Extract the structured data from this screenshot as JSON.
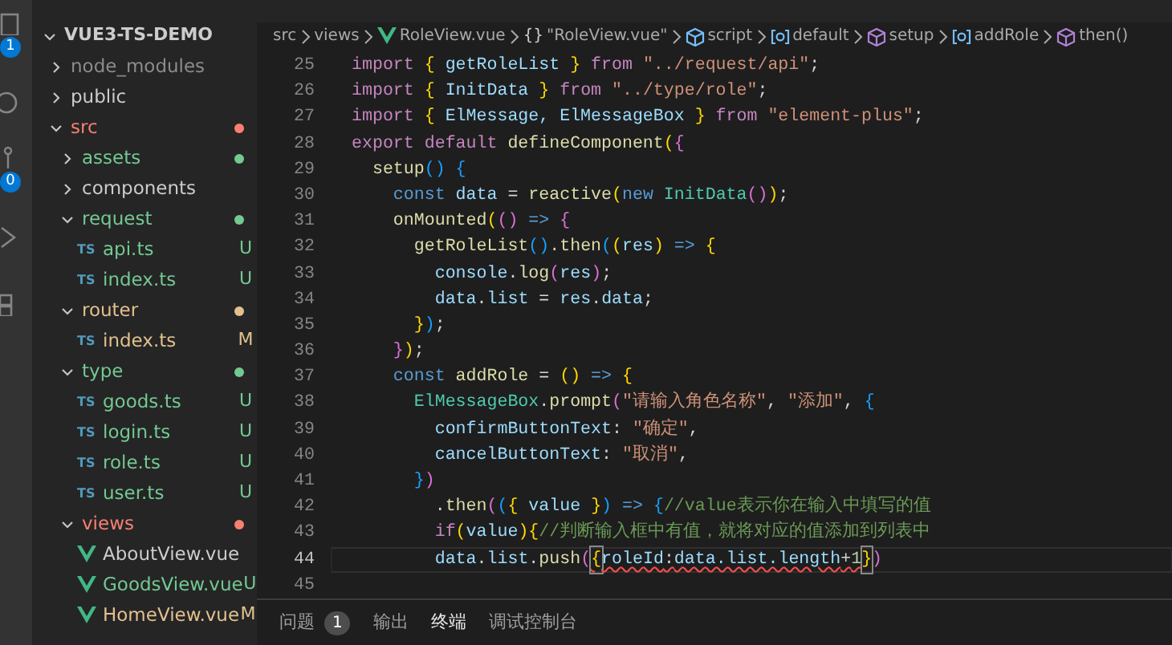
{
  "activity_bar": [
    {
      "kind": "explorer",
      "badge": "1"
    },
    {
      "kind": "search"
    },
    {
      "kind": "source-control",
      "badge": "0"
    },
    {
      "kind": "run"
    },
    {
      "kind": "extensions"
    }
  ],
  "explorer": {
    "label": "VUE3-TS-DEMO",
    "expanded": true,
    "children": [
      {
        "label": "node_modules",
        "kind": "folder",
        "expanded": false,
        "color": "#8c8c8c"
      },
      {
        "label": "public",
        "kind": "folder",
        "expanded": false,
        "color": "#cccccc"
      },
      {
        "label": "src",
        "kind": "folder",
        "expanded": true,
        "color": "#f88070",
        "dot": true,
        "children": [
          {
            "label": "assets",
            "kind": "folder",
            "expanded": false,
            "color": "#73c991",
            "dot": true
          },
          {
            "label": "components",
            "kind": "folder",
            "expanded": false,
            "color": "#cccccc"
          },
          {
            "label": "request",
            "kind": "folder",
            "expanded": true,
            "color": "#73c991",
            "dot": true,
            "children": [
              {
                "label": "api.ts",
                "kind": "ts",
                "icon_text": "TS",
                "color": "#73c991",
                "status": "U"
              },
              {
                "label": "index.ts",
                "kind": "ts",
                "icon_text": "TS",
                "color": "#73c991",
                "status": "U"
              }
            ]
          },
          {
            "label": "router",
            "kind": "folder",
            "expanded": true,
            "color": "#e2c08d",
            "dot": true,
            "children": [
              {
                "label": "index.ts",
                "kind": "ts",
                "icon_text": "TS",
                "color": "#e2c08d",
                "status": "M"
              }
            ]
          },
          {
            "label": "type",
            "kind": "folder",
            "expanded": true,
            "color": "#73c991",
            "dot": true,
            "children": [
              {
                "label": "goods.ts",
                "kind": "ts",
                "icon_text": "TS",
                "color": "#73c991",
                "status": "U"
              },
              {
                "label": "login.ts",
                "kind": "ts",
                "icon_text": "TS",
                "color": "#73c991",
                "status": "U"
              },
              {
                "label": "role.ts",
                "kind": "ts",
                "icon_text": "TS",
                "color": "#73c991",
                "status": "U"
              },
              {
                "label": "user.ts",
                "kind": "ts",
                "icon_text": "TS",
                "color": "#73c991",
                "status": "U"
              }
            ]
          },
          {
            "label": "views",
            "kind": "folder",
            "expanded": true,
            "color": "#f88070",
            "dot": true,
            "children": [
              {
                "label": "AboutView.vue",
                "kind": "vue",
                "color": "#cccccc"
              },
              {
                "label": "GoodsView.vue",
                "kind": "vue",
                "color": "#73c991",
                "status": "U"
              },
              {
                "label": "HomeView.vue",
                "kind": "vue",
                "color": "#e2c08d",
                "status": "M"
              }
            ]
          }
        ]
      }
    ]
  },
  "breadcrumb": [
    {
      "label": "src",
      "kind": "folder"
    },
    {
      "label": "views",
      "kind": "folder"
    },
    {
      "label": "RoleView.vue",
      "kind": "vue"
    },
    {
      "label": "\"RoleView.vue\"",
      "kind": "module",
      "icon_text": "{}"
    },
    {
      "label": "script",
      "kind": "script"
    },
    {
      "label": "default",
      "kind": "field"
    },
    {
      "label": "setup",
      "kind": "method"
    },
    {
      "label": "addRole",
      "kind": "field"
    },
    {
      "label": "then()",
      "kind": "method"
    }
  ],
  "editor": {
    "lines": [
      {
        "number": "25",
        "tokens": [
          {
            "kind": "kw",
            "text": "import "
          },
          {
            "kind": "b1",
            "text": "{"
          },
          {
            "kind": "var",
            "text": " getRoleList "
          },
          {
            "kind": "b1",
            "text": "}"
          },
          {
            "kind": "kw",
            "text": " from "
          },
          {
            "kind": "str",
            "text": "\"../request/api\""
          },
          {
            "kind": "p",
            "text": ";"
          }
        ]
      },
      {
        "number": "26",
        "tokens": [
          {
            "kind": "kw",
            "text": "import "
          },
          {
            "kind": "b1",
            "text": "{"
          },
          {
            "kind": "var",
            "text": " InitData "
          },
          {
            "kind": "b1",
            "text": "}"
          },
          {
            "kind": "kw",
            "text": " from "
          },
          {
            "kind": "str",
            "text": "\"../type/role\""
          },
          {
            "kind": "p",
            "text": ";"
          }
        ]
      },
      {
        "number": "27",
        "tokens": [
          {
            "kind": "kw",
            "text": "import "
          },
          {
            "kind": "b1",
            "text": "{"
          },
          {
            "kind": "var",
            "text": " ElMessage, ElMessageBox "
          },
          {
            "kind": "b1",
            "text": "}"
          },
          {
            "kind": "kw",
            "text": " from "
          },
          {
            "kind": "str",
            "text": "\"element-plus\""
          },
          {
            "kind": "p",
            "text": ";"
          }
        ]
      },
      {
        "number": "28",
        "tokens": [
          {
            "kind": "kw",
            "text": "export default "
          },
          {
            "kind": "fn",
            "text": "defineComponent"
          },
          {
            "kind": "b1",
            "text": "("
          },
          {
            "kind": "b2",
            "text": "{"
          }
        ]
      },
      {
        "number": "29",
        "tokens": [
          {
            "kind": "fn",
            "text": "  setup"
          },
          {
            "kind": "b3",
            "text": "()"
          },
          {
            "kind": "b3",
            "text": " {"
          }
        ]
      },
      {
        "number": "30",
        "tokens": [
          {
            "kind": "st",
            "text": "    const "
          },
          {
            "kind": "var",
            "text": "data"
          },
          {
            "kind": "p",
            "text": " = "
          },
          {
            "kind": "fn",
            "text": "reactive"
          },
          {
            "kind": "b1",
            "text": "("
          },
          {
            "kind": "st",
            "text": "new "
          },
          {
            "kind": "cls",
            "text": "InitData"
          },
          {
            "kind": "b2",
            "text": "()"
          },
          {
            "kind": "b1",
            "text": ")"
          },
          {
            "kind": "p",
            "text": ";"
          }
        ]
      },
      {
        "number": "31",
        "tokens": [
          {
            "kind": "fn",
            "text": "    onMounted"
          },
          {
            "kind": "b1",
            "text": "("
          },
          {
            "kind": "b2",
            "text": "()"
          },
          {
            "kind": "st",
            "text": " => "
          },
          {
            "kind": "b2",
            "text": "{"
          }
        ]
      },
      {
        "number": "32",
        "tokens": [
          {
            "kind": "fn",
            "text": "      getRoleList"
          },
          {
            "kind": "b3",
            "text": "()"
          },
          {
            "kind": "p",
            "text": "."
          },
          {
            "kind": "fn",
            "text": "then"
          },
          {
            "kind": "b3",
            "text": "("
          },
          {
            "kind": "b1",
            "text": "("
          },
          {
            "kind": "var",
            "text": "res"
          },
          {
            "kind": "b1",
            "text": ")"
          },
          {
            "kind": "st",
            "text": " => "
          },
          {
            "kind": "b1",
            "text": "{"
          }
        ]
      },
      {
        "number": "33",
        "tokens": [
          {
            "kind": "var",
            "text": "        console"
          },
          {
            "kind": "p",
            "text": "."
          },
          {
            "kind": "fn",
            "text": "log"
          },
          {
            "kind": "b2",
            "text": "("
          },
          {
            "kind": "var",
            "text": "res"
          },
          {
            "kind": "b2",
            "text": ")"
          },
          {
            "kind": "p",
            "text": ";"
          }
        ]
      },
      {
        "number": "34",
        "tokens": [
          {
            "kind": "var",
            "text": "        data"
          },
          {
            "kind": "p",
            "text": "."
          },
          {
            "kind": "var",
            "text": "list"
          },
          {
            "kind": "p",
            "text": " = "
          },
          {
            "kind": "var",
            "text": "res"
          },
          {
            "kind": "p",
            "text": "."
          },
          {
            "kind": "var",
            "text": "data"
          },
          {
            "kind": "p",
            "text": ";"
          }
        ]
      },
      {
        "number": "35",
        "tokens": [
          {
            "kind": "b1",
            "text": "      }"
          },
          {
            "kind": "b3",
            "text": ")"
          },
          {
            "kind": "p",
            "text": ";"
          }
        ]
      },
      {
        "number": "36",
        "tokens": [
          {
            "kind": "b2",
            "text": "    }"
          },
          {
            "kind": "b1",
            "text": ")"
          },
          {
            "kind": "p",
            "text": ";"
          }
        ]
      },
      {
        "number": "37",
        "tokens": [
          {
            "kind": "st",
            "text": "    const "
          },
          {
            "kind": "fn",
            "text": "addRole"
          },
          {
            "kind": "p",
            "text": " = "
          },
          {
            "kind": "b1",
            "text": "()"
          },
          {
            "kind": "st",
            "text": " => "
          },
          {
            "kind": "b1",
            "text": "{"
          }
        ]
      },
      {
        "number": "38",
        "tokens": [
          {
            "kind": "cls",
            "text": "      ElMessageBox"
          },
          {
            "kind": "p",
            "text": "."
          },
          {
            "kind": "fn",
            "text": "prompt"
          },
          {
            "kind": "b2",
            "text": "("
          },
          {
            "kind": "str",
            "text": "\"请输入角色名称\""
          },
          {
            "kind": "p",
            "text": ", "
          },
          {
            "kind": "str",
            "text": "\"添加\""
          },
          {
            "kind": "p",
            "text": ", "
          },
          {
            "kind": "b3",
            "text": "{"
          }
        ]
      },
      {
        "number": "39",
        "tokens": [
          {
            "kind": "var",
            "text": "        confirmButtonText"
          },
          {
            "kind": "p",
            "text": ": "
          },
          {
            "kind": "str",
            "text": "\"确定\""
          },
          {
            "kind": "p",
            "text": ","
          }
        ]
      },
      {
        "number": "40",
        "tokens": [
          {
            "kind": "var",
            "text": "        cancelButtonText"
          },
          {
            "kind": "p",
            "text": ": "
          },
          {
            "kind": "str",
            "text": "\"取消\""
          },
          {
            "kind": "p",
            "text": ","
          }
        ]
      },
      {
        "number": "41",
        "tokens": [
          {
            "kind": "b3",
            "text": "      }"
          },
          {
            "kind": "b2",
            "text": ")"
          }
        ]
      },
      {
        "number": "42",
        "tokens": [
          {
            "kind": "p",
            "text": "        ."
          },
          {
            "kind": "fn",
            "text": "then"
          },
          {
            "kind": "b2",
            "text": "("
          },
          {
            "kind": "b3",
            "text": "("
          },
          {
            "kind": "b1",
            "text": "{"
          },
          {
            "kind": "var",
            "text": " value "
          },
          {
            "kind": "b1",
            "text": "}"
          },
          {
            "kind": "b3",
            "text": ")"
          },
          {
            "kind": "st",
            "text": " => "
          },
          {
            "kind": "b3",
            "text": "{"
          },
          {
            "kind": "cm",
            "text": "//value表示你在输入中填写的值"
          }
        ]
      },
      {
        "number": "43",
        "tokens": [
          {
            "kind": "kw",
            "text": "        if"
          },
          {
            "kind": "b1",
            "text": "("
          },
          {
            "kind": "var",
            "text": "value"
          },
          {
            "kind": "b1",
            "text": ")"
          },
          {
            "kind": "b1",
            "text": "{"
          },
          {
            "kind": "cm",
            "text": "//判断输入框中有值，就将对应的值添加到列表中"
          }
        ]
      },
      {
        "number": "44",
        "current": true,
        "tokens": [
          {
            "kind": "var",
            "text": "        data"
          },
          {
            "kind": "p",
            "text": "."
          },
          {
            "kind": "var",
            "text": "list"
          },
          {
            "kind": "p",
            "text": "."
          },
          {
            "kind": "fn",
            "text": "push"
          },
          {
            "kind": "b2",
            "text": "("
          },
          {
            "kind": "b1",
            "text": "{",
            "matched": true,
            "error": true
          },
          {
            "kind": "var",
            "text": "roleId",
            "error": true
          },
          {
            "kind": "p",
            "text": ":",
            "error": true
          },
          {
            "kind": "var",
            "text": "data.list.length",
            "error": true
          },
          {
            "kind": "p",
            "text": "+",
            "error": true
          },
          {
            "kind": "num",
            "text": "1",
            "error": true
          },
          {
            "kind": "b1",
            "text": "}",
            "matched": true
          },
          {
            "kind": "b2",
            "text": ")"
          }
        ]
      },
      {
        "number": "45"
      }
    ]
  },
  "panel": {
    "tabs": [
      {
        "label": "问题",
        "badge": "1",
        "selected": false
      },
      {
        "label": "输出",
        "selected": false
      },
      {
        "label": "终端",
        "selected": true
      },
      {
        "label": "调试控制台",
        "selected": false
      }
    ]
  }
}
